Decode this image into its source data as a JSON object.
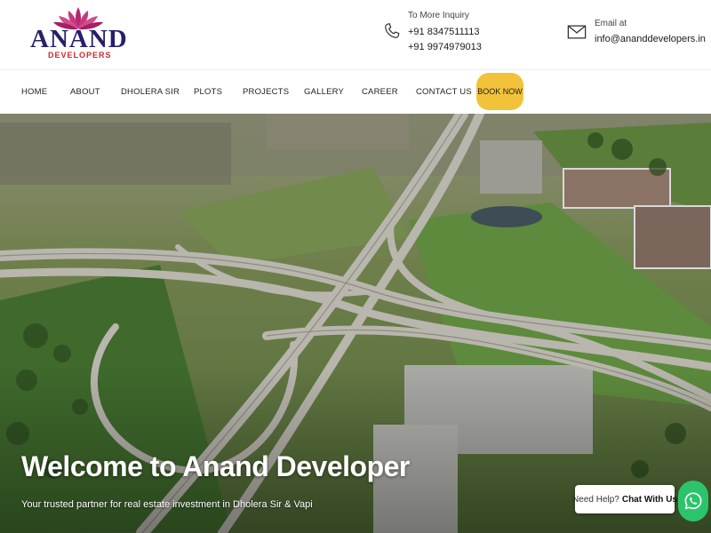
{
  "brand": {
    "name": "ANAND",
    "tagline": "DEVELOPERS"
  },
  "inquiry": {
    "label": "To More Inquiry",
    "phones": [
      "+91 8347511113",
      "+91 9974979013"
    ],
    "icon": "phone-icon"
  },
  "email": {
    "label": "Email at",
    "address": "info@ananddevelopers.in",
    "icon": "mail-icon"
  },
  "nav": {
    "items": [
      "HOME",
      "ABOUT",
      "DHOLERA SIR",
      "PLOTS",
      "PROJECTS",
      "GALLERY",
      "CAREER",
      "CONTACT US"
    ],
    "cta": "BOOK NOW",
    "cta_color": "#f2c23b"
  },
  "hero": {
    "title": "Welcome to Anand Developer",
    "subtitle": "Your trusted partner for real estate investment in Dholera Sir & Vapi"
  },
  "chat": {
    "prefix": "Need Help?",
    "action": "Chat With Us",
    "icon": "whatsapp-icon",
    "color": "#2bc46b"
  },
  "colors": {
    "brand_navy": "#26206a",
    "brand_red": "#d0282e",
    "lotus_magenta": "#b3286f"
  }
}
